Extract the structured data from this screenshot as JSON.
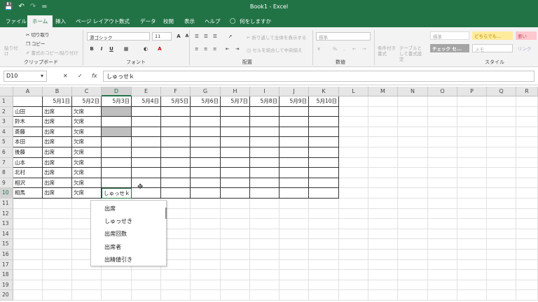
{
  "titlebar": {
    "title": "Book1  -  Excel",
    "save_icon": "save-icon",
    "undo_icon": "undo-icon",
    "redo_icon": "redo-icon",
    "customize": "="
  },
  "tabs": [
    {
      "label": "ファイル",
      "active": false
    },
    {
      "label": "ホーム",
      "active": true
    },
    {
      "label": "挿入",
      "active": false
    },
    {
      "label": "ページ レイアウト",
      "active": false
    },
    {
      "label": "数式",
      "active": false
    },
    {
      "label": "データ",
      "active": false
    },
    {
      "label": "校閲",
      "active": false
    },
    {
      "label": "表示",
      "active": false
    },
    {
      "label": "ヘルプ",
      "active": false
    }
  ],
  "tellme": "何をしますか",
  "ribbon": {
    "clipboard": {
      "paste": "貼り付け",
      "cut": "切り取り",
      "copy": "コピー",
      "format_painter": "書式のコピー/貼り付け",
      "label": "クリップボード"
    },
    "font": {
      "name": "游ゴシック",
      "size": "11",
      "bold": "B",
      "italic": "I",
      "underline": "U",
      "grow": "A",
      "shrink": "A",
      "color_a": "A",
      "label": "フォント"
    },
    "align": {
      "wrap": "折り返して全体を表示する",
      "merge": "セルを結合して中央揃え",
      "label": "配置"
    },
    "number": {
      "format": "標準",
      "pct": "%",
      "comma": ",",
      "label": "数値"
    },
    "styles": {
      "conditional": "条件付き書式",
      "table": "テーブルとして書式設定",
      "standard": "標準",
      "neutral": "どちらでも...",
      "bad": "悪い",
      "check": "チェック セ...",
      "memo": "メモ",
      "link": "リンク",
      "label": "スタイル"
    }
  },
  "formula": {
    "namebox": "D10",
    "cancel": "✕",
    "enter": "✓",
    "fx": "fx",
    "value": "しゅっせｋ"
  },
  "columns": [
    "A",
    "B",
    "C",
    "D",
    "E",
    "F",
    "G",
    "H",
    "I",
    "J",
    "K",
    "L",
    "M",
    "N",
    "O",
    "P",
    "Q",
    "R"
  ],
  "rows": [
    "1",
    "2",
    "3",
    "4",
    "5",
    "6",
    "7",
    "8",
    "9",
    "10",
    "11",
    "12",
    "13",
    "14",
    "15",
    "16",
    "17",
    "18",
    "19",
    "20"
  ],
  "dates": [
    "5月1日",
    "5月2日",
    "5月3日",
    "5月4日",
    "5月5日",
    "5月6日",
    "5月7日",
    "5月8日",
    "5月9日",
    "5月10日"
  ],
  "names": [
    "山田",
    "鈴木",
    "斎藤",
    "本田",
    "後藤",
    "山本",
    "北村",
    "相沢",
    "相馬"
  ],
  "colB": [
    "出席",
    "出席",
    "出席",
    "出席",
    "出席",
    "出席",
    "出席",
    "出席",
    "出席"
  ],
  "colC": [
    "欠席",
    "欠席",
    "欠席",
    "欠席",
    "欠席",
    "欠席",
    "欠席",
    "欠席",
    "欠席"
  ],
  "active_text": "しゅっせｋ",
  "autocomplete": [
    "出席",
    "しゅっせき",
    "出席回数",
    "出席者",
    "出精値引き"
  ]
}
